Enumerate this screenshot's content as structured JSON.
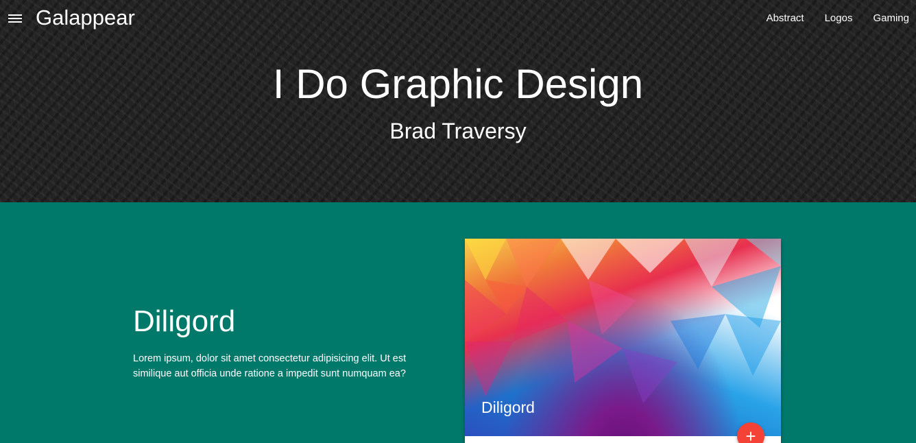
{
  "header": {
    "menu_icon": "hamburger-menu-icon",
    "brand": "Galappear",
    "nav": [
      {
        "label": "Abstract"
      },
      {
        "label": "Logos"
      },
      {
        "label": "Gaming"
      }
    ]
  },
  "hero": {
    "title": "I Do Graphic Design",
    "subtitle": "Brad Traversy"
  },
  "section": {
    "title": "Diligord",
    "text": "Lorem ipsum, dolor sit amet consectetur adipisicing elit. Ut est similique aut officia unde ratione a impedit sunt numquam ea?"
  },
  "card": {
    "caption": "Diligord",
    "fab_icon": "plus-icon",
    "fab_symbol": "+"
  },
  "colors": {
    "hero_bg": "#232323",
    "section_bg": "#00796b",
    "fab": "#f44336"
  }
}
